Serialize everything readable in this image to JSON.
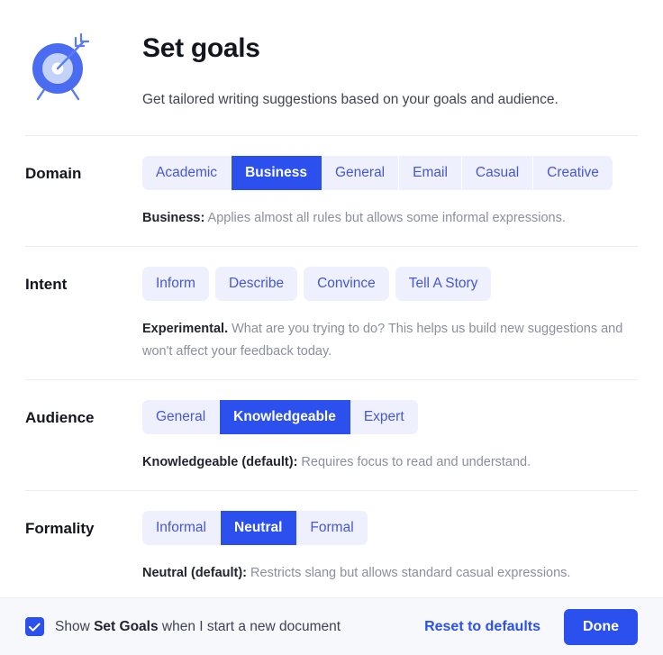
{
  "header": {
    "icon": "target-goal-icon",
    "title": "Set goals",
    "subtitle": "Get tailored writing suggestions based on your goals and audience."
  },
  "colors": {
    "accent": "#2b50ed",
    "pill_background": "#eef1fd",
    "pill_text": "#4557d6",
    "divider": "#eceef5",
    "footer_background": "#f7f8fc",
    "help_text": "#8a8f9e"
  },
  "sections": [
    {
      "label": "Domain",
      "control": "segmented",
      "options": [
        {
          "label": "Academic",
          "selected": false
        },
        {
          "label": "Business",
          "selected": true
        },
        {
          "label": "General",
          "selected": false
        },
        {
          "label": "Email",
          "selected": false
        },
        {
          "label": "Casual",
          "selected": false
        },
        {
          "label": "Creative",
          "selected": false
        }
      ],
      "help_strong": "Business:",
      "help_rest": " Applies almost all rules but allows some informal expressions."
    },
    {
      "label": "Intent",
      "control": "pills",
      "options": [
        {
          "label": "Inform",
          "selected": false
        },
        {
          "label": "Describe",
          "selected": false
        },
        {
          "label": "Convince",
          "selected": false
        },
        {
          "label": "Tell A Story",
          "selected": false
        }
      ],
      "help_strong": "Experimental.",
      "help_rest": " What are you trying to do? This helps us build new suggestions and won't affect your feedback today."
    },
    {
      "label": "Audience",
      "control": "segmented",
      "options": [
        {
          "label": "General",
          "selected": false
        },
        {
          "label": "Knowledgeable",
          "selected": true
        },
        {
          "label": "Expert",
          "selected": false
        }
      ],
      "help_strong": "Knowledgeable (default):",
      "help_rest": " Requires focus to read and understand."
    },
    {
      "label": "Formality",
      "control": "segmented",
      "options": [
        {
          "label": "Informal",
          "selected": false
        },
        {
          "label": "Neutral",
          "selected": true
        },
        {
          "label": "Formal",
          "selected": false
        }
      ],
      "help_strong": "Neutral (default):",
      "help_rest": " Restricts slang but allows standard casual expressions."
    }
  ],
  "footer": {
    "checkbox_checked": true,
    "checkbox_label_pre": "Show ",
    "checkbox_label_strong": "Set Goals",
    "checkbox_label_post": " when I start a new document",
    "reset_label": "Reset to defaults",
    "done_label": "Done"
  }
}
